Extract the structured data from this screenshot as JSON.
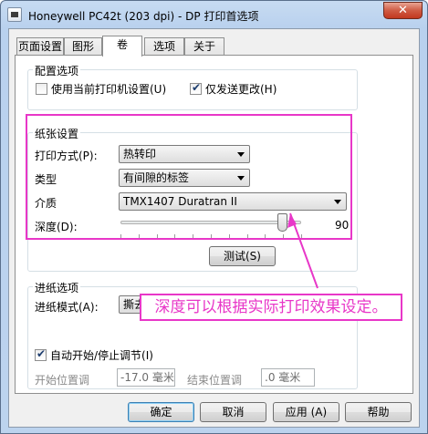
{
  "window": {
    "title": "Honeywell PC42t (203 dpi) - DP 打印首选项",
    "close_glyph": "✕"
  },
  "tabs": [
    {
      "label": "页面设置"
    },
    {
      "label": "图形"
    },
    {
      "label": "卷"
    },
    {
      "label": "选项"
    },
    {
      "label": "关于"
    }
  ],
  "active_tab": "卷",
  "config_group": {
    "title": "配置选项",
    "use_current_printer": {
      "label": "使用当前打印机设置(U)",
      "checked": false
    },
    "send_changes_only": {
      "label": "仅发送更改(H)",
      "checked": true
    }
  },
  "paper_group": {
    "title": "纸张设置",
    "print_method": {
      "label": "打印方式(P):",
      "value": "热转印"
    },
    "type": {
      "label": "类型",
      "value": "有间隙的标签"
    },
    "media": {
      "label": "介质",
      "value": "TMX1407 Duratran II"
    },
    "darkness": {
      "label": "深度(D):",
      "value": "90",
      "fraction": 0.9
    },
    "test_button": "测试(S)"
  },
  "feed_group": {
    "title": "进纸选项",
    "feed_mode": {
      "label": "进纸模式(A):",
      "value": "撕去"
    },
    "auto_start_stop": {
      "label": "自动开始/停止调节(I)",
      "checked": true
    },
    "start_pos": {
      "label": "开始位置调",
      "value": "-17.0 毫米"
    },
    "end_pos": {
      "label": "结束位置调",
      "value": ".0 毫米"
    }
  },
  "annotation": {
    "text": "深度可以根据实际打印效果设定。",
    "color": "#e837c8"
  },
  "buttons": {
    "ok": "确定",
    "cancel": "取消",
    "apply": "应用 (A)",
    "help": "帮助"
  },
  "check_glyph": "✔"
}
